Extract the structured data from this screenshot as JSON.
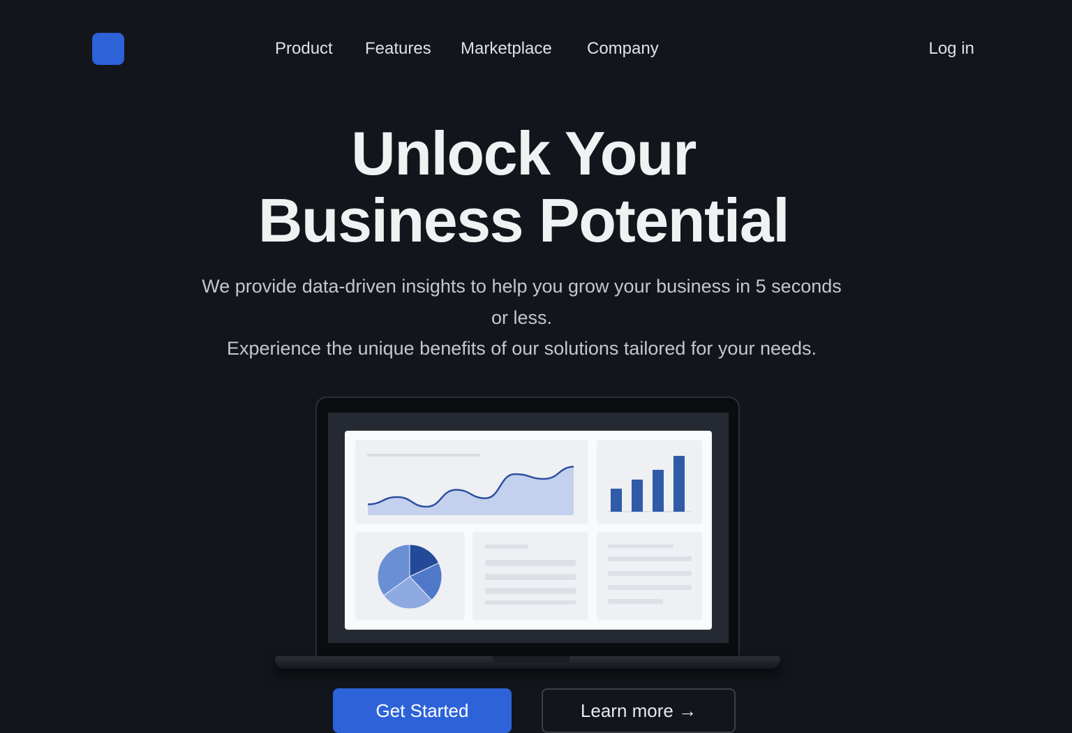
{
  "nav": {
    "items": [
      {
        "label": "Product"
      },
      {
        "label": "Features"
      },
      {
        "label": "Marketplace"
      },
      {
        "label": "Company"
      }
    ],
    "login_label": "Log in"
  },
  "hero": {
    "title_line1": "Unlock Your",
    "title_line2": "Business Potential",
    "subtitle_line1": "We provide data-driven insights to help you grow your business in 5 seconds",
    "subtitle_line2": "or less.",
    "subtitle_line3": "Experience the unique benefits of our solutions tailored for your needs."
  },
  "actions": {
    "primary_label": "Get Started",
    "secondary_label": "Learn more →"
  },
  "colors": {
    "background": "#12151b",
    "accent": "#2d62d8",
    "chart_dark": "#2f5ba8",
    "chart_fill": "#c3d1ee"
  },
  "dashboard_preview": {
    "line_series": [
      18,
      30,
      14,
      42,
      28,
      68,
      60,
      80
    ],
    "bar_series": [
      33,
      46,
      60,
      80
    ],
    "pie_slices": [
      0.18,
      0.2,
      0.27,
      0.35
    ]
  }
}
